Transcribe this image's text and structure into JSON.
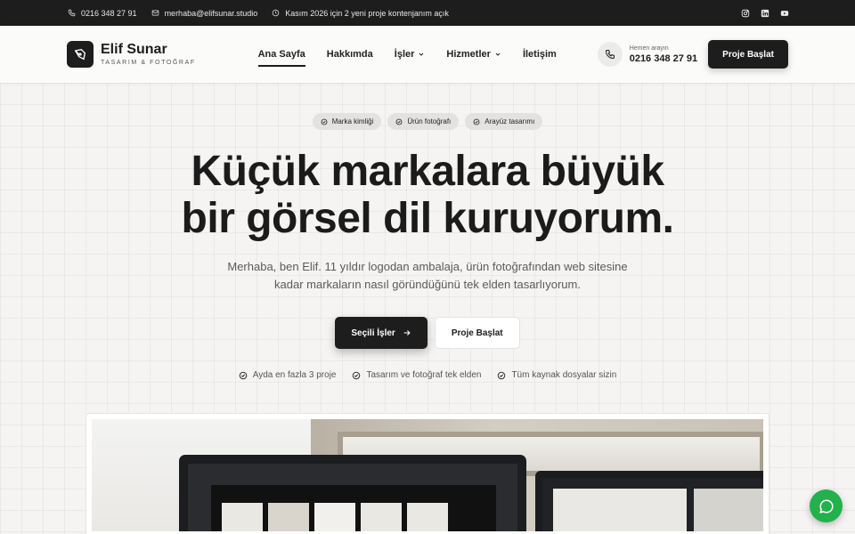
{
  "topbar": {
    "phone": "0216 348 27 91",
    "email": "merhaba@elifsunar.studio",
    "availability": "Kasım 2026 için 2 yeni proje kontenjanım açık",
    "social": [
      "instagram-icon",
      "linkedin-icon",
      "youtube-icon"
    ]
  },
  "header": {
    "brand_name": "Elif Sunar",
    "brand_tagline": "TASARIM & FOTOĞRAF",
    "nav": [
      {
        "label": "Ana Sayfa",
        "active": true
      },
      {
        "label": "Hakkımda",
        "active": false
      },
      {
        "label": "İşler",
        "dropdown": true
      },
      {
        "label": "Hizmetler",
        "dropdown": true
      },
      {
        "label": "İletişim",
        "active": false
      }
    ],
    "call_label": "Hemen arayın",
    "call_number": "0216 348 27 91",
    "cta": "Proje Başlat"
  },
  "hero": {
    "chips": [
      "Marka kimliği",
      "Ürün fotoğrafı",
      "Arayüz tasarımı"
    ],
    "title_line1": "Küçük markalara büyük",
    "title_line2": "bir görsel dil kuruyorum.",
    "lead_line1": "Merhaba, ben Elif. 11 yıldır logodan ambalaja, ürün fotoğrafından web sitesine",
    "lead_line2": "kadar markaların nasıl göründüğünü tek elden tasarlıyorum.",
    "primary_cta": "Seçili İşler",
    "secondary_cta": "Proje Başlat",
    "features": [
      "Ayda en fazla 3 proje",
      "Tasarım ve fotoğraf tek elden",
      "Tüm kaynak dosyalar sizin"
    ]
  },
  "colors": {
    "dark": "#1d1d1d",
    "background": "#f5f4f2",
    "whatsapp": "#22b14c"
  }
}
